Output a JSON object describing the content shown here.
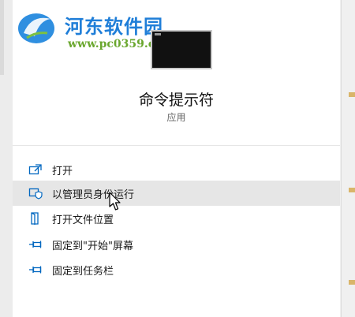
{
  "watermark": {
    "title": "河东软件园",
    "url": "www.pc0359.cn"
  },
  "app": {
    "name": "命令提示符",
    "type": "应用",
    "thumbnail_icon": "console-window-icon"
  },
  "menu": {
    "items": [
      {
        "label": "打开",
        "icon": "open-external-icon"
      },
      {
        "label": "以管理员身份运行",
        "icon": "run-as-admin-shield-icon"
      },
      {
        "label": "打开文件位置",
        "icon": "file-location-icon"
      },
      {
        "label": "固定到\"开始\"屏幕",
        "icon": "pin-icon"
      },
      {
        "label": "固定到任务栏",
        "icon": "pin-icon"
      }
    ],
    "hovered_index": 1
  },
  "colors": {
    "accent": "#0067c0",
    "hover": "#e6e6e6",
    "watermark_blue": "#1f7ed8",
    "watermark_green": "#6aa72e"
  }
}
